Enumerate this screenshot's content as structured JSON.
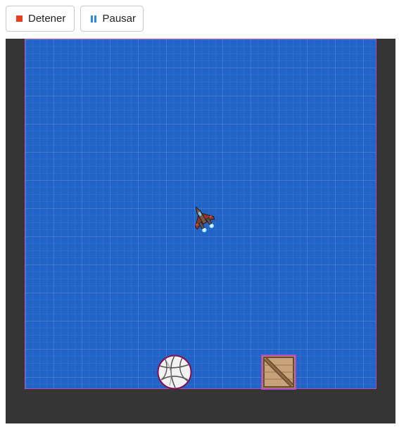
{
  "toolbar": {
    "stop_label": "Detener",
    "pause_label": "Pausar",
    "stop_icon": "stop-icon",
    "pause_icon": "pause-icon"
  },
  "colors": {
    "stop_accent": "#e8401c",
    "pause_accent": "#2b8be0",
    "arena_background": "#2263c8",
    "arena_border": "#b44cc8",
    "stage_background": "#353535"
  },
  "sprites": {
    "player": "spaceship-icon",
    "ball": "volleyball-icon",
    "crate": "wooden-crate-icon"
  }
}
